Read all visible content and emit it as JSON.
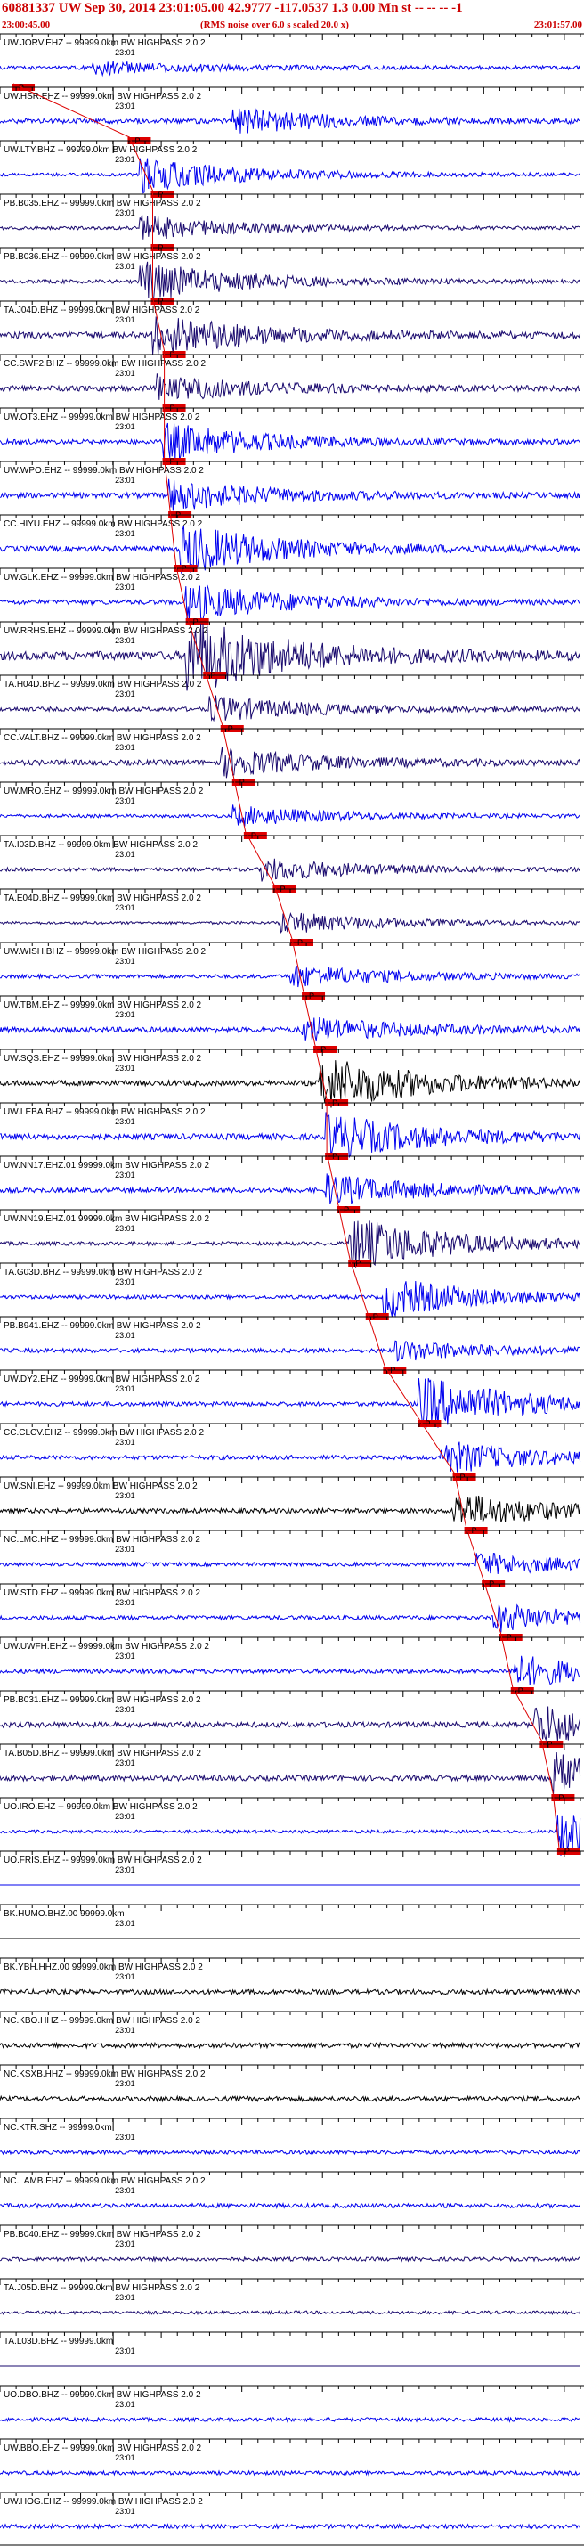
{
  "header": {
    "title": "60881337 UW Sep 30, 2014 23:01:05.00   42.9777 -117.0537  1.3 0.00 Mn st -- -- --  -1",
    "start_time": "23:00:45.00",
    "rms_note": "(RMS noise over 6.0 s scaled 20.0 x)",
    "end_time": "23:01:57.00"
  },
  "colors": {
    "trace_blue": "#0000ee",
    "trace_navy": "#1a0a6e",
    "trace_black": "#000000",
    "pick_red": "#dd0000"
  },
  "chart_data": {
    "type": "seismogram",
    "title": "60881337 UW Sep 30, 2014 23:01:05.00   42.9777 -117.0537  1.3 0.00 Mn st -- -- --  -1",
    "time_range": [
      "23:00:45.00",
      "23:01:57.00"
    ],
    "minute_label": "23:01",
    "pick_label": "P",
    "traces": [
      {
        "label": "UW.JORV.EHZ -- 99999.0km BW  HIGHPASS  2.0  2",
        "color": "#0000ee",
        "amp": 0.35,
        "burst_start": 0.16,
        "burst_amp": 0.5,
        "pick": 0.02
      },
      {
        "label": "UW.HSR.EHZ -- 99999.0km BW  HIGHPASS  2.0  2",
        "color": "#0000ee",
        "amp": 0.45,
        "burst_start": 0.4,
        "burst_amp": 1.0,
        "pick": 0.22
      },
      {
        "label": "UW.LTY.BHZ -- 99999.0km BW  HIGHPASS  2.0  2",
        "color": "#0000ee",
        "amp": 0.3,
        "burst_start": 0.24,
        "burst_amp": 1.4,
        "pick": 0.26
      },
      {
        "label": "PB.B035.EHZ -- 99999.0km BW  HIGHPASS  2.0  2",
        "color": "#1a0a6e",
        "amp": 0.3,
        "burst_start": 0.24,
        "burst_amp": 1.0,
        "pick": 0.26
      },
      {
        "label": "PB.B036.EHZ -- 99999.0km BW  HIGHPASS  2.0  2",
        "color": "#1a0a6e",
        "amp": 0.35,
        "burst_start": 0.24,
        "burst_amp": 1.6,
        "pick": 0.26
      },
      {
        "label": "TA.J04D.BHZ -- 99999.0km BW  HIGHPASS  2.0  2",
        "color": "#1a0a6e",
        "amp": 0.6,
        "burst_start": 0.26,
        "burst_amp": 1.7,
        "pick": 0.28
      },
      {
        "label": "CC.SWF2.BHZ -- 99999.0km BW  HIGHPASS  2.0  2",
        "color": "#1a0a6e",
        "amp": 0.5,
        "burst_start": 0.27,
        "burst_amp": 1.0,
        "pick": 0.28
      },
      {
        "label": "UW.OT3.EHZ -- 99999.0km BW  HIGHPASS  2.0  2",
        "color": "#0000ee",
        "amp": 0.45,
        "burst_start": 0.28,
        "burst_amp": 1.5,
        "pick": 0.28
      },
      {
        "label": "UW.WPO.EHZ -- 99999.0km BW  HIGHPASS  2.0  2",
        "color": "#0000ee",
        "amp": 0.5,
        "burst_start": 0.29,
        "burst_amp": 1.2,
        "pick": 0.29
      },
      {
        "label": "CC.HIYU.EHZ -- 99999.0km BW  HIGHPASS  2.0  2",
        "color": "#0000ee",
        "amp": 0.5,
        "burst_start": 0.31,
        "burst_amp": 2.0,
        "pick": 0.3
      },
      {
        "label": "UW.GLK.EHZ -- 99999.0km BW  HIGHPASS  2.0  2",
        "color": "#0000ee",
        "amp": 0.45,
        "burst_start": 0.32,
        "burst_amp": 1.5,
        "pick": 0.32
      },
      {
        "label": "UW.RRHS.EHZ -- 99999.0km BW  HIGHPASS  2.0  2",
        "color": "#1a0a6e",
        "amp": 0.8,
        "burst_start": 0.32,
        "burst_amp": 3.0,
        "pick": 0.35
      },
      {
        "label": "TA.H04D.BHZ -- 99999.0km BW  HIGHPASS  2.0  2",
        "color": "#1a0a6e",
        "amp": 0.4,
        "burst_start": 0.36,
        "burst_amp": 1.0,
        "pick": 0.38
      },
      {
        "label": "CC.VALT.BHZ -- 99999.0km BW  HIGHPASS  2.0  2",
        "color": "#1a0a6e",
        "amp": 0.5,
        "burst_start": 0.38,
        "burst_amp": 1.1,
        "pick": 0.4
      },
      {
        "label": "UW.MRO.EHZ -- 99999.0km BW  HIGHPASS  2.0  2",
        "color": "#0000ee",
        "amp": 0.3,
        "burst_start": 0.4,
        "burst_amp": 0.8,
        "pick": 0.42
      },
      {
        "label": "TA.I03D.BHZ -- 99999.0km BW  HIGHPASS  2.0  2",
        "color": "#1a0a6e",
        "amp": 0.35,
        "burst_start": 0.45,
        "burst_amp": 0.9,
        "pick": 0.47
      },
      {
        "label": "TA.E04D.BHZ -- 99999.0km BW  HIGHPASS  2.0  2",
        "color": "#1a0a6e",
        "amp": 0.25,
        "burst_start": 0.48,
        "burst_amp": 0.9,
        "pick": 0.5
      },
      {
        "label": "UW.WISH.BHZ -- 99999.0km BW  HIGHPASS  2.0  2",
        "color": "#0000ee",
        "amp": 0.35,
        "burst_start": 0.5,
        "burst_amp": 0.9,
        "pick": 0.52
      },
      {
        "label": "UW.TBM.EHZ -- 99999.0km BW  HIGHPASS  2.0  2",
        "color": "#0000ee",
        "amp": 0.5,
        "burst_start": 0.52,
        "burst_amp": 1.0,
        "pick": 0.54
      },
      {
        "label": "UW.SQS.EHZ -- 99999.0km BW  HIGHPASS  2.0  2",
        "color": "#000000",
        "amp": 0.5,
        "burst_start": 0.55,
        "burst_amp": 2.2,
        "pick": 0.56
      },
      {
        "label": "UW.LEBA.BHZ -- 99999.0km BW  HIGHPASS  2.0  2",
        "color": "#0000ee",
        "amp": 0.55,
        "burst_start": 0.56,
        "burst_amp": 1.8,
        "pick": 0.56
      },
      {
        "label": "UW.NN17.EHZ.01 99999.0km BW  HIGHPASS  2.0  2",
        "color": "#0000ee",
        "amp": 0.45,
        "burst_start": 0.56,
        "burst_amp": 1.2,
        "pick": 0.58
      },
      {
        "label": "UW.NN19.EHZ.01 99999.0km BW  HIGHPASS  2.0  2",
        "color": "#1a0a6e",
        "amp": 0.35,
        "burst_start": 0.6,
        "burst_amp": 2.2,
        "pick": 0.6
      },
      {
        "label": "TA.G03D.BHZ -- 99999.0km BW  HIGHPASS  2.0  2",
        "color": "#0000ee",
        "amp": 0.35,
        "burst_start": 0.66,
        "burst_amp": 1.6,
        "pick": 0.63
      },
      {
        "label": "PB.B941.EHZ -- 99999.0km BW  HIGHPASS  2.0  2",
        "color": "#0000ee",
        "amp": 0.4,
        "burst_start": 0.68,
        "burst_amp": 0.8,
        "pick": 0.66
      },
      {
        "label": "UW.DY2.EHZ -- 99999.0km BW  HIGHPASS  2.0  2",
        "color": "#0000ee",
        "amp": 0.4,
        "burst_start": 0.72,
        "burst_amp": 2.2,
        "pick": 0.72
      },
      {
        "label": "CC.CLCV.EHZ -- 99999.0km BW  HIGHPASS  2.0  2",
        "color": "#0000ee",
        "amp": 0.4,
        "burst_start": 0.76,
        "burst_amp": 1.3,
        "pick": 0.78
      },
      {
        "label": "UW.SNI.EHZ -- 99999.0km BW  HIGHPASS  2.0  2",
        "color": "#000000",
        "amp": 0.45,
        "burst_start": 0.78,
        "burst_amp": 1.4,
        "pick": 0.8
      },
      {
        "label": "NC.LMC.HHZ -- 99999.0km BW  HIGHPASS  2.0  2",
        "color": "#0000ee",
        "amp": 0.35,
        "burst_start": 0.82,
        "burst_amp": 0.9,
        "pick": 0.83
      },
      {
        "label": "UW.STD.EHZ -- 99999.0km BW  HIGHPASS  2.0  2",
        "color": "#0000ee",
        "amp": 0.4,
        "burst_start": 0.85,
        "burst_amp": 1.1,
        "pick": 0.86
      },
      {
        "label": "UW.UWFH.EHZ -- 99999.0km BW  HIGHPASS  2.0  2",
        "color": "#0000ee",
        "amp": 0.4,
        "burst_start": 0.88,
        "burst_amp": 1.3,
        "pick": 0.88
      },
      {
        "label": "PB.B031.EHZ -- 99999.0km BW  HIGHPASS  2.0  2",
        "color": "#1a0a6e",
        "amp": 0.5,
        "burst_start": 0.92,
        "burst_amp": 1.6,
        "pick": 0.93
      },
      {
        "label": "TA.B05D.BHZ -- 99999.0km BW  HIGHPASS  2.0  2",
        "color": "#1a0a6e",
        "amp": 0.5,
        "burst_start": 0.95,
        "burst_amp": 2.0,
        "pick": 0.95
      },
      {
        "label": "UO.IRO.EHZ -- 99999.0km BW  HIGHPASS  2.0  2",
        "color": "#0000ee",
        "amp": 0.3,
        "burst_start": 0.96,
        "burst_amp": 2.0,
        "pick": 0.96
      },
      {
        "label": "UO.FRIS.EHZ -- 99999.0km BW  HIGHPASS  2.0  2",
        "color": "#0000ee",
        "amp": 0.0,
        "burst_start": 2.0,
        "burst_amp": 0.0,
        "pick": null
      },
      {
        "label": "BK.HUMO.BHZ.00 99999.0km",
        "color": "#000000",
        "amp": 0.0,
        "burst_start": 2.0,
        "burst_amp": 0.0,
        "pick": null
      },
      {
        "label": "BK.YBH.HHZ.00 99999.0km BW  HIGHPASS  2.0  2",
        "color": "#000000",
        "amp": 0.45,
        "burst_start": 2.0,
        "burst_amp": 0.0,
        "pick": null
      },
      {
        "label": "NC.KBO.HHZ -- 99999.0km BW  HIGHPASS  2.0  2",
        "color": "#000000",
        "amp": 0.45,
        "burst_start": 2.0,
        "burst_amp": 0.0,
        "pick": null
      },
      {
        "label": "NC.KSXB.HHZ -- 99999.0km BW  HIGHPASS  2.0  2",
        "color": "#000000",
        "amp": 0.45,
        "burst_start": 2.0,
        "burst_amp": 0.0,
        "pick": null
      },
      {
        "label": "NC.KTR.SHZ -- 99999.0km",
        "color": "#0000ee",
        "amp": 0.35,
        "burst_start": 2.0,
        "burst_amp": 0.0,
        "pick": null
      },
      {
        "label": "NC.LAMB.EHZ -- 99999.0km BW  HIGHPASS  2.0  2",
        "color": "#0000ee",
        "amp": 0.4,
        "burst_start": 2.0,
        "burst_amp": 0.0,
        "pick": null
      },
      {
        "label": "PB.B040.EHZ -- 99999.0km BW  HIGHPASS  2.0  2",
        "color": "#1a0a6e",
        "amp": 0.35,
        "burst_start": 2.0,
        "burst_amp": 0.0,
        "pick": null
      },
      {
        "label": "TA.J05D.BHZ -- 99999.0km BW  HIGHPASS  2.0  2",
        "color": "#1a0a6e",
        "amp": 0.3,
        "burst_start": 2.0,
        "burst_amp": 0.0,
        "pick": null
      },
      {
        "label": "TA.L03D.BHZ -- 99999.0km",
        "color": "#1a0a6e",
        "amp": 0.0,
        "burst_start": 2.0,
        "burst_amp": 0.0,
        "pick": null
      },
      {
        "label": "UO.DBO.BHZ -- 99999.0km BW  HIGHPASS  2.0  2",
        "color": "#0000ee",
        "amp": 0.35,
        "burst_start": 2.0,
        "burst_amp": 0.0,
        "pick": null
      },
      {
        "label": "UW.BBO.EHZ -- 99999.0km BW  HIGHPASS  2.0  2",
        "color": "#0000ee",
        "amp": 0.35,
        "burst_start": 2.0,
        "burst_amp": 0.0,
        "pick": null
      },
      {
        "label": "UW.HOG.EHZ -- 99999.0km BW  HIGHPASS  2.0  2",
        "color": "#0000ee",
        "amp": 0.4,
        "burst_start": 2.0,
        "burst_amp": 0.0,
        "pick": null
      }
    ]
  }
}
